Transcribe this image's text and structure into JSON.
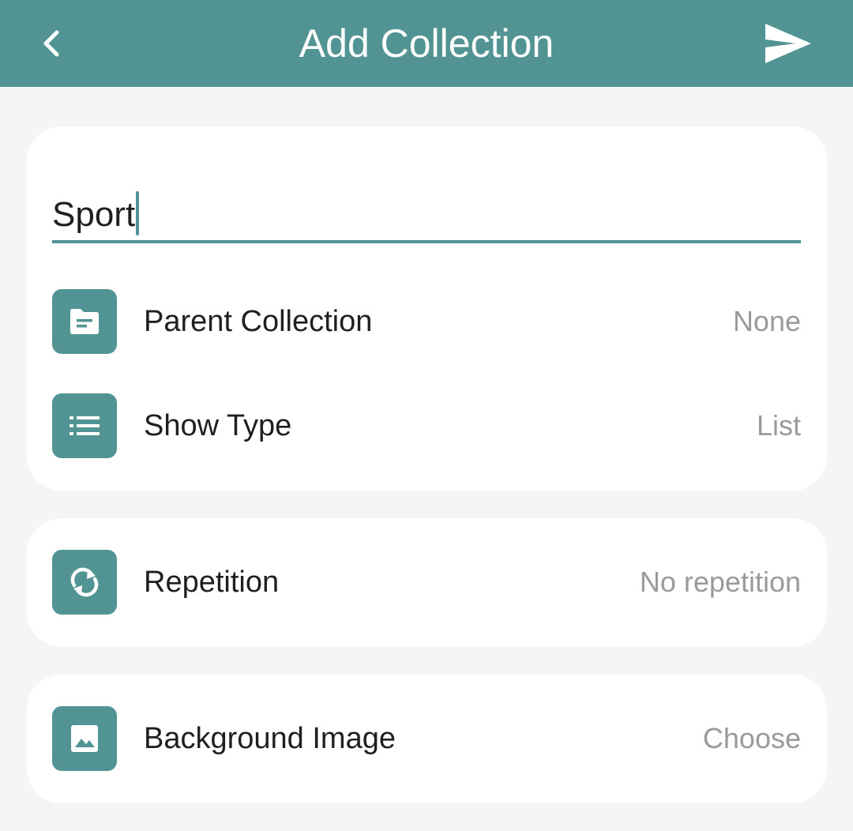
{
  "colors": {
    "accent": "#529494",
    "background": "#f5f5f5",
    "card": "#ffffff",
    "text_primary": "#1f1f1f",
    "text_secondary": "#9a9a9a"
  },
  "header": {
    "title": "Add Collection",
    "back_icon": "chevron-left-icon",
    "send_icon": "send-icon"
  },
  "form": {
    "name_value": "Sport",
    "rows": [
      {
        "icon": "folder-icon",
        "label": "Parent Collection",
        "value": "None"
      },
      {
        "icon": "list-icon",
        "label": "Show Type",
        "value": "List"
      }
    ],
    "repetition": {
      "icon": "repeat-icon",
      "label": "Repetition",
      "value": "No repetition"
    },
    "background": {
      "icon": "image-icon",
      "label": "Background Image",
      "value": "Choose"
    }
  }
}
